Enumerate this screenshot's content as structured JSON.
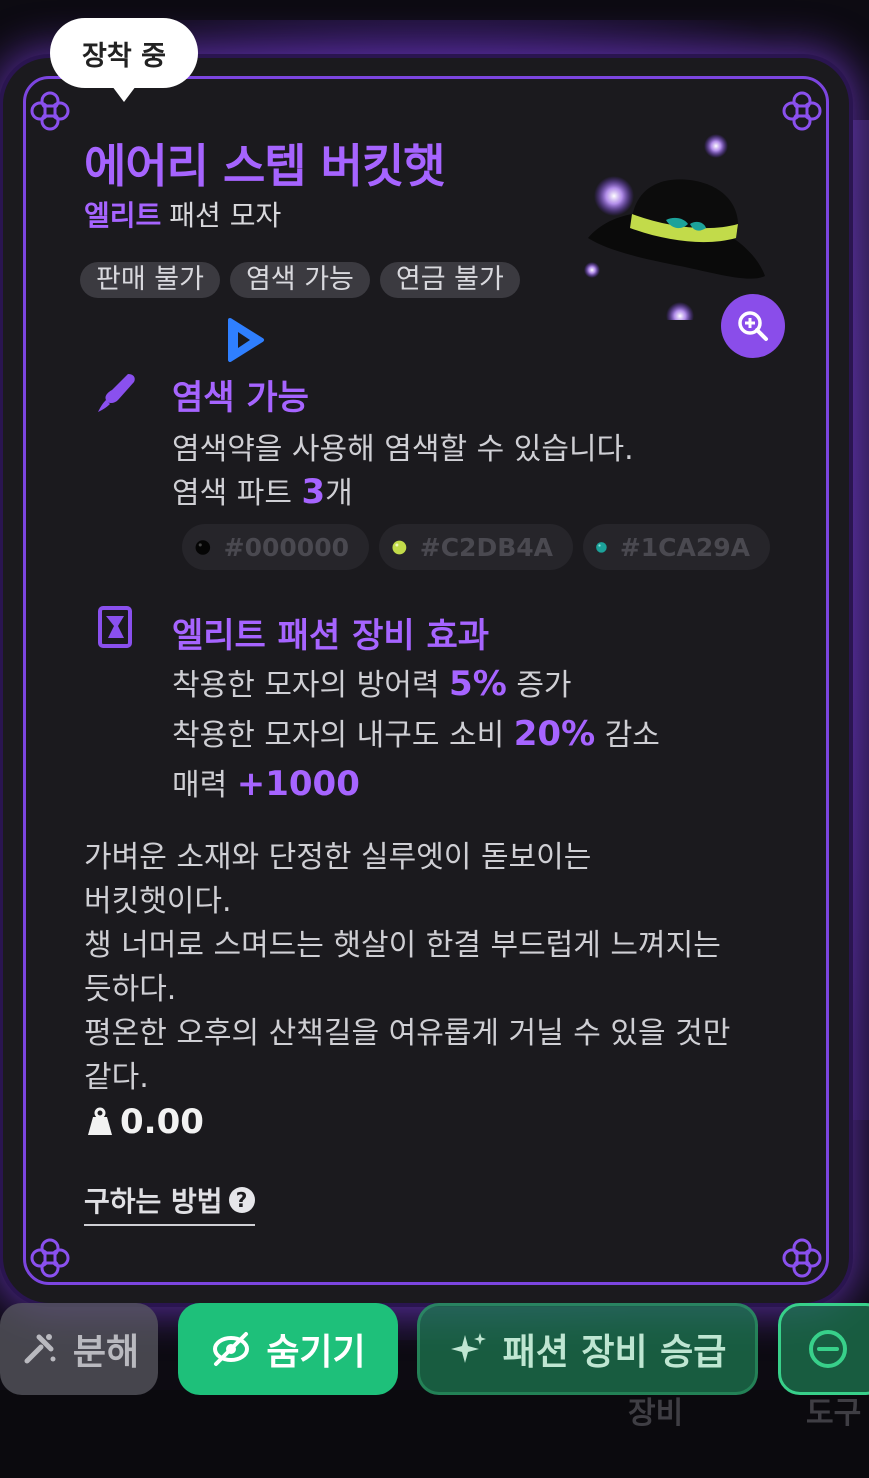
{
  "equipped_badge": "장착 중",
  "item": {
    "name": "에어리 스텝 버킷햇",
    "grade": "엘리트",
    "category": "패션 모자",
    "tags": [
      "판매 불가",
      "염색 가능",
      "연금 불가"
    ]
  },
  "dye": {
    "title": "염색 가능",
    "description": "염색약을 사용해 염색할 수 있습니다.",
    "parts_label": "염색 파트",
    "parts_count": "3",
    "parts_unit": "개",
    "colors": [
      {
        "hex": "#000000",
        "swatch": "#0a0a0a"
      },
      {
        "hex": "#C2DB4A",
        "swatch": "#C2DB4A"
      },
      {
        "hex": "#1CA29A",
        "swatch": "#1CA29A"
      }
    ]
  },
  "effect": {
    "title": "엘리트 패션 장비 효과",
    "line1_pre": "착용한 모자의 방어력",
    "line1_value": "5%",
    "line1_post": "증가",
    "line2_pre": "착용한 모자의 내구도 소비",
    "line2_value": "20%",
    "line2_post": "감소",
    "line3_pre": "매력",
    "line3_value": "+1000"
  },
  "description": [
    "가벼운 소재와 단정한 실루엣이 돋보이는",
    "버킷햇이다.",
    "챙 너머로 스며드는 햇살이 한결 부드럽게 느껴지는",
    "듯하다.",
    "평온한 오후의 산책길을 여유롭게 거닐 수 있을 것만",
    "같다."
  ],
  "weight": "0.00",
  "how_to_obtain": "구하는 방법",
  "actions": {
    "dismantle": "분해",
    "hide": "숨기기",
    "upgrade": "패션 장비 승급"
  },
  "background_labels": {
    "equip": "장비",
    "tool": "도구"
  },
  "colors": {
    "accent": "#A664FF",
    "hide_button": "#1EC07A",
    "card_bg": "#1B1A1E"
  }
}
